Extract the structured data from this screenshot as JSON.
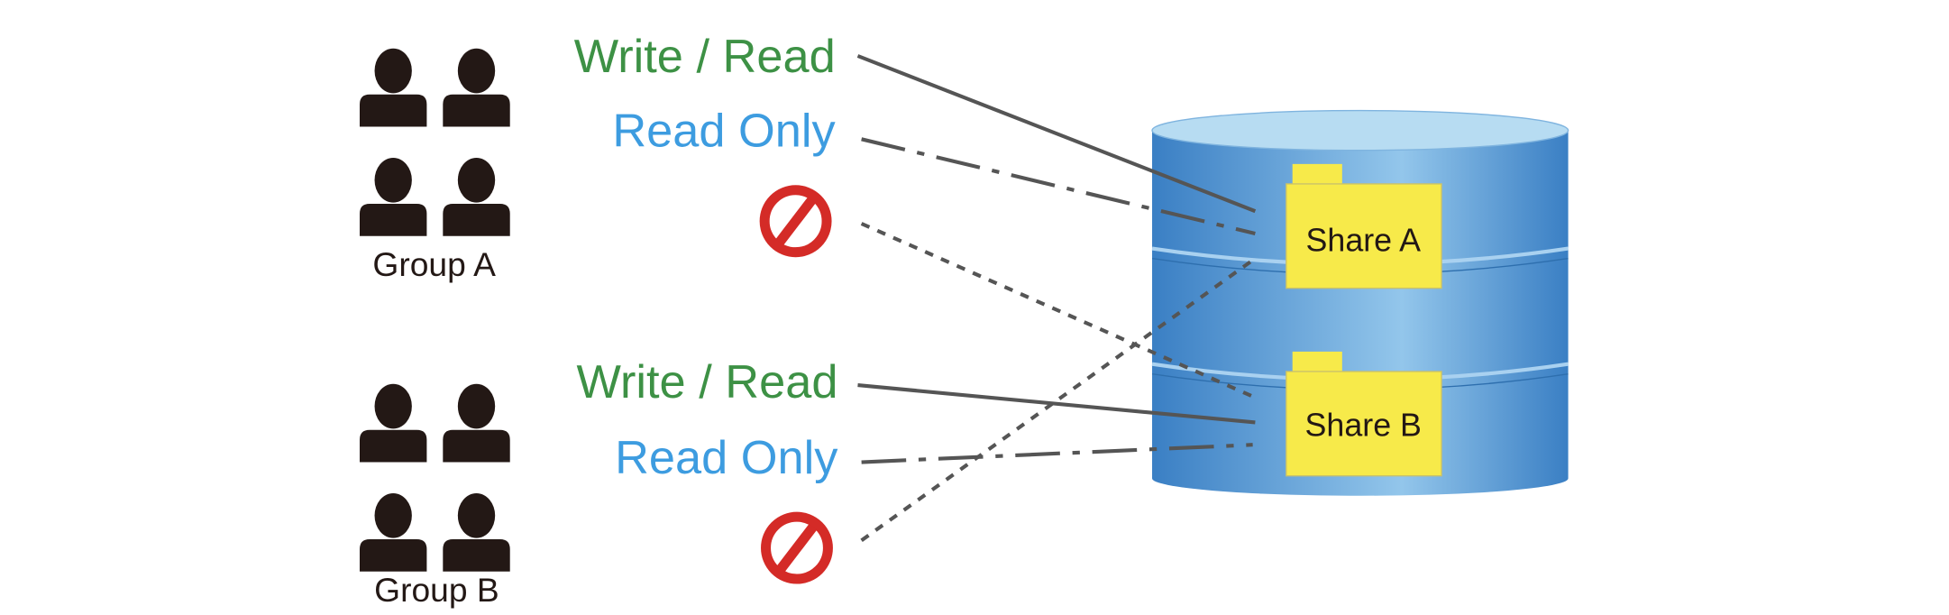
{
  "colors": {
    "write_read": "#3d9145",
    "read_only": "#3d9ce0",
    "prohibit": "#d42b27",
    "person": "#231815",
    "folder": "#f7ea4a",
    "cylinder": "#5a9ad6",
    "line": "#555555"
  },
  "groups": [
    {
      "label": "Group A",
      "permissions": {
        "write_read": "Write / Read",
        "read_only": "Read Only"
      },
      "denied_icon": "prohibited-icon"
    },
    {
      "label": "Group B",
      "permissions": {
        "write_read": "Write / Read",
        "read_only": "Read Only"
      },
      "denied_icon": "prohibited-icon"
    }
  ],
  "shares": [
    {
      "label": "Share A"
    },
    {
      "label": "Share B"
    }
  ],
  "connections": [
    {
      "from": "Group A",
      "permission": "Write / Read",
      "to": "Share A",
      "line_style": "solid"
    },
    {
      "from": "Group A",
      "permission": "Read Only",
      "to": "Share A",
      "line_style": "dash-dot"
    },
    {
      "from": "Group A",
      "permission": "denied",
      "to": "Share B",
      "line_style": "dotted"
    },
    {
      "from": "Group B",
      "permission": "Write / Read",
      "to": "Share B",
      "line_style": "solid"
    },
    {
      "from": "Group B",
      "permission": "Read Only",
      "to": "Share B",
      "line_style": "dash-dot"
    },
    {
      "from": "Group B",
      "permission": "denied",
      "to": "Share A",
      "line_style": "dotted"
    }
  ]
}
